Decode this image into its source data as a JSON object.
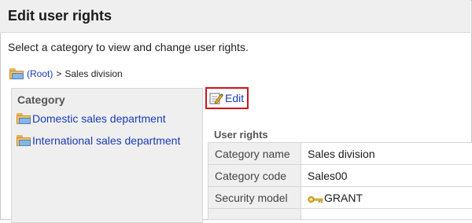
{
  "page": {
    "title": "Edit user rights",
    "description": "Select a category to view and change user rights."
  },
  "breadcrumb": {
    "root_label": "(Root)",
    "separator": ">",
    "current": "Sales division",
    "icon": "folder-icon"
  },
  "category_panel": {
    "heading": "Category",
    "items": [
      {
        "label": "Domestic sales department",
        "icon": "folder-icon"
      },
      {
        "label": "International sales department",
        "icon": "folder-icon"
      }
    ]
  },
  "toolbar": {
    "edit_label": "Edit",
    "edit_icon": "edit-pencil-icon",
    "highlight_color": "#d0121b"
  },
  "user_rights": {
    "heading": "User rights",
    "rows": [
      {
        "key": "Category name",
        "value": "Sales division"
      },
      {
        "key": "Category code",
        "value": "Sales00"
      },
      {
        "key": "Security model",
        "value": "GRANT",
        "icon": "key-icon"
      }
    ]
  },
  "colors": {
    "link": "#1a3cb5",
    "panel_bg": "#efefef",
    "border": "#d6d6d6"
  }
}
